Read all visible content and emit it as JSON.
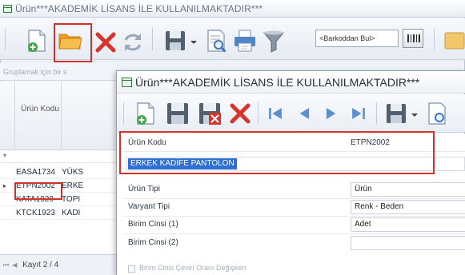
{
  "window": {
    "title": "Ürün***AKADEMİK LİSANS İLE KULLANILMAKTADIR***"
  },
  "toolbar": {
    "barcode_search_label": "<Barkoddan Bul>",
    "icons": [
      "new-icon",
      "open-folder-icon",
      "delete-icon",
      "refresh-icon",
      "save-dropdown-icon",
      "preview-icon",
      "print-icon",
      "filter-icon",
      "barcode-icon"
    ]
  },
  "grid": {
    "group_hint": "Gruplamak için bir s",
    "column_code": "Ürün Kodu",
    "rows": [
      {
        "indicator": "",
        "code": "EASA1734",
        "name": "YÜKS"
      },
      {
        "indicator": "▸",
        "code": "ETPN2002",
        "name": "ERKE"
      },
      {
        "indicator": "",
        "code": "KATA1929",
        "name": "TOPI"
      },
      {
        "indicator": "",
        "code": "KTCK1923",
        "name": "KADI"
      }
    ],
    "pager": {
      "text": "Kayıt 2 / 4"
    }
  },
  "dialog": {
    "title": "Ürün***AKADEMİK LİSANS İLE KULLANILMAKTADIR***",
    "toolbar_icons": [
      "new-icon",
      "save-icon",
      "save-close-icon",
      "delete-icon",
      "first-record-icon",
      "previous-record-icon",
      "next-record-icon",
      "last-record-icon",
      "save-dropdown-icon"
    ],
    "fields": {
      "code_label": "Ürün Kodu",
      "code_value": "ETPN2002",
      "name_value": "ERKEK KADİFE PANTOLON",
      "type_label": "Ürün Tipi",
      "type_value": "Ürün",
      "variant_label": "Varyant Tipi",
      "variant_value": "Renk - Beden",
      "unit1_label": "Birim Cinsi (1)",
      "unit1_value": "Adet",
      "unit2_label": "Birim Cinsi (2)",
      "unit2_value": "",
      "conversion_label": "Birim Cinsi Çeviri Oranı Değişken"
    }
  },
  "colors": {
    "highlight": "#d6302b",
    "selection": "#2f6fd1"
  }
}
